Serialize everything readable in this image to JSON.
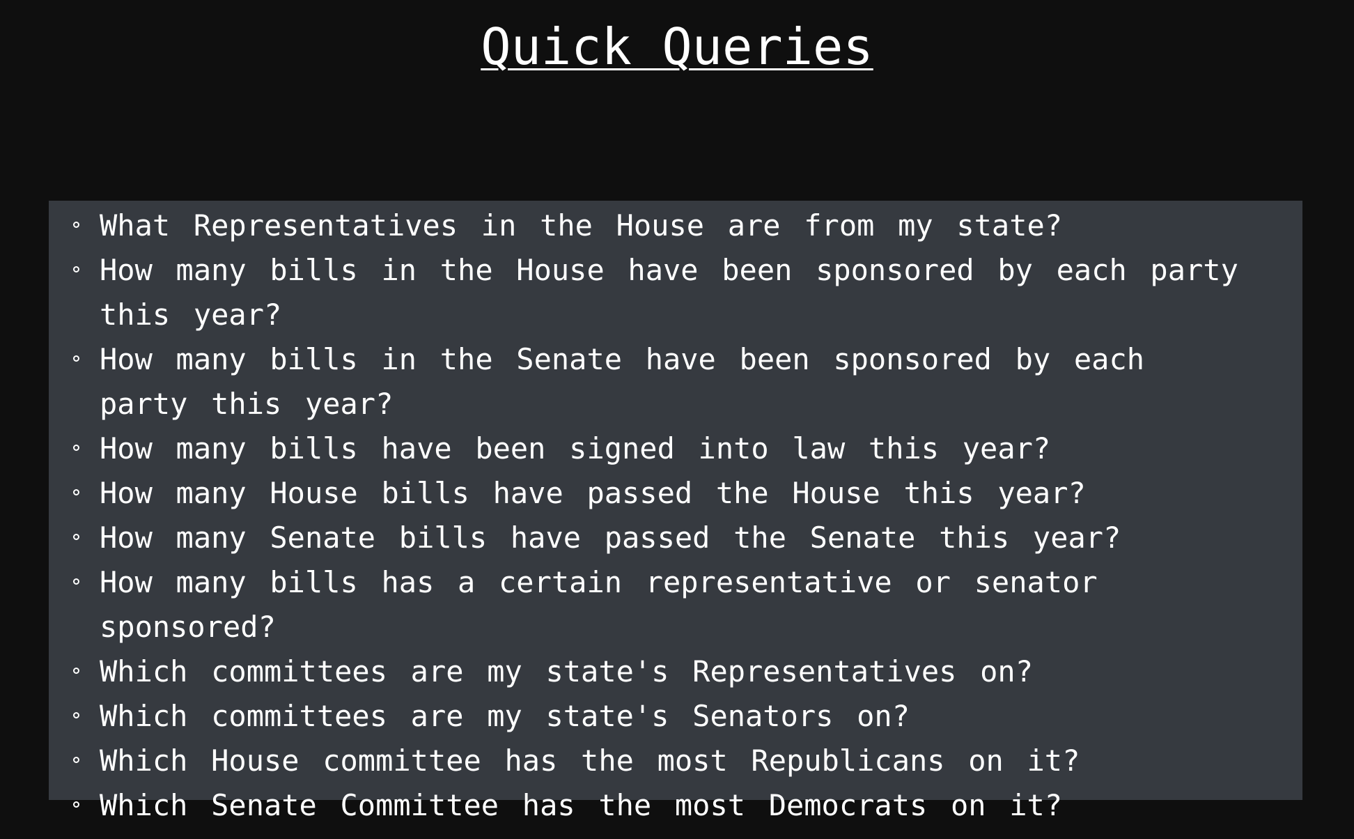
{
  "header": {
    "title": "Quick Queries"
  },
  "queries": [
    {
      "text": "What Representatives in the House are from my state?"
    },
    {
      "text": "How many bills in the House have been sponsored by each party this year?"
    },
    {
      "text": "How many bills in the Senate have been sponsored by each party this year?"
    },
    {
      "text": "How many bills have been signed into law this year?"
    },
    {
      "text": "How many House bills have passed the House this year?"
    },
    {
      "text": "How many Senate bills have passed the Senate this year?"
    },
    {
      "text": "How many bills has a certain representative or senator sponsored?"
    },
    {
      "text": "Which committees are my state's Representatives on?"
    },
    {
      "text": "Which committees are my state's Senators on?"
    },
    {
      "text": "Which House committee has the most Republicans on it?"
    },
    {
      "text": "Which Senate Committee has the most Democrats on it?"
    }
  ],
  "colors": {
    "background": "#0f0f0f",
    "panel": "#363a40",
    "text": "#ffffff"
  }
}
